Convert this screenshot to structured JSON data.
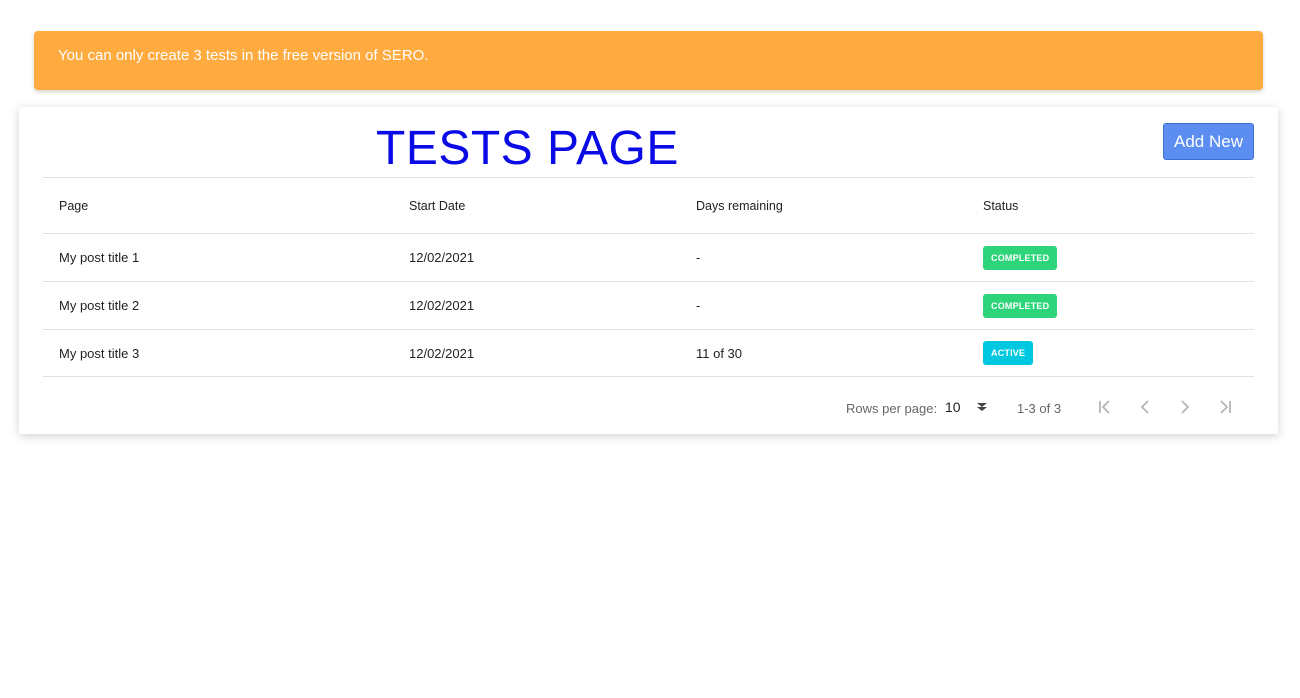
{
  "notice": {
    "text": "You can only create 3 tests in the free version of SERO."
  },
  "page": {
    "title": "TESTS PAGE",
    "add_button": "Add New"
  },
  "table": {
    "columns": [
      "Page",
      "Start Date",
      "Days remaining",
      "Status"
    ],
    "rows": [
      {
        "page": "My post title 1",
        "start_date": "12/02/2021",
        "days_remaining": "-",
        "status": "COMPLETED",
        "status_color": "#2ed47a"
      },
      {
        "page": "My post title 2",
        "start_date": "12/02/2021",
        "days_remaining": "-",
        "status": "COMPLETED",
        "status_color": "#2ed47a"
      },
      {
        "page": "My post title 3",
        "start_date": "12/02/2021",
        "days_remaining": "11 of 30",
        "status": "ACTIVE",
        "status_color": "#00c8e0"
      }
    ]
  },
  "pagination": {
    "rows_per_page_label": "Rows per page:",
    "rows_per_page_value": "10",
    "range": "1-3 of 3"
  },
  "colors": {
    "notice_bg": "#ffab40",
    "title": "#0a0ae6",
    "primary_button": "#5b8ef0",
    "completed": "#2ed47a",
    "active": "#00c8e0"
  },
  "icons": {
    "select": "chevron-double-down-icon",
    "first": "first-page-icon",
    "prev": "chevron-left-icon",
    "next": "chevron-right-icon",
    "last": "last-page-icon"
  }
}
